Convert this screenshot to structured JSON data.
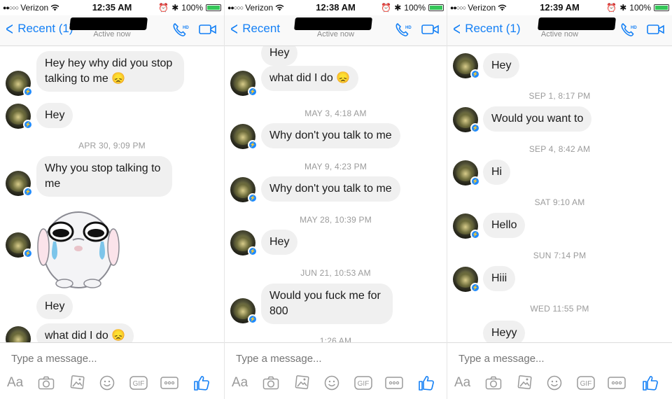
{
  "panels": [
    {
      "status": {
        "carrier": "Verizon",
        "time": "12:35 AM",
        "battery": "100%"
      },
      "nav": {
        "back_label": "Recent (1)",
        "subtitle": "Active now"
      },
      "messages": [
        {
          "type": "text",
          "text": "Hey hey why did you stop talking to me 😞"
        },
        {
          "type": "text",
          "text": "Hey"
        },
        {
          "type": "timestamp",
          "text": "APR 30, 9:09 PM"
        },
        {
          "type": "text",
          "text": "Why you stop talking to me"
        },
        {
          "type": "sticker",
          "description": "crying-bunny-sticker"
        },
        {
          "type": "text",
          "text": "Hey"
        },
        {
          "type": "text",
          "text": "what did I do 😞"
        }
      ],
      "composer": {
        "placeholder": "Type a message..."
      }
    },
    {
      "status": {
        "carrier": "Verizon",
        "time": "12:38 AM",
        "battery": "100%"
      },
      "nav": {
        "back_label": "Recent",
        "subtitle": "Active now"
      },
      "messages": [
        {
          "type": "text",
          "text": "Hey"
        },
        {
          "type": "text",
          "text": "what did I do 😞"
        },
        {
          "type": "timestamp",
          "text": "MAY 3, 4:18 AM"
        },
        {
          "type": "text",
          "text": "Why don't you talk to me"
        },
        {
          "type": "timestamp",
          "text": "MAY 9, 4:23 PM"
        },
        {
          "type": "text",
          "text": "Why don't you talk to me"
        },
        {
          "type": "timestamp",
          "text": "MAY 28, 10:39 PM"
        },
        {
          "type": "text",
          "text": "Hey"
        },
        {
          "type": "timestamp",
          "text": "JUN 21, 10:53 AM"
        },
        {
          "type": "text",
          "text": "Would you fuck me for 800"
        },
        {
          "type": "timestamp",
          "text": "1:26 AM"
        }
      ],
      "composer": {
        "placeholder": "Type a message..."
      }
    },
    {
      "status": {
        "carrier": "Verizon",
        "time": "12:39 AM",
        "battery": "100%"
      },
      "nav": {
        "back_label": "Recent (1)",
        "subtitle": "Active now"
      },
      "messages": [
        {
          "type": "text",
          "text": "Hey"
        },
        {
          "type": "timestamp",
          "text": "SEP 1, 8:17 PM"
        },
        {
          "type": "text",
          "text": "Would you want to"
        },
        {
          "type": "timestamp",
          "text": "SEP 4, 8:42 AM"
        },
        {
          "type": "text",
          "text": "Hi"
        },
        {
          "type": "timestamp",
          "text": "SAT 9:10 AM"
        },
        {
          "type": "text",
          "text": "Hello"
        },
        {
          "type": "timestamp",
          "text": "SUN 7:14 PM"
        },
        {
          "type": "text",
          "text": "Hiii"
        },
        {
          "type": "timestamp",
          "text": "WED 11:55 PM"
        },
        {
          "type": "text",
          "text": "Heyy"
        }
      ],
      "composer": {
        "placeholder": "Type a message..."
      }
    }
  ],
  "toolbar": {
    "aa_label": "Aa",
    "gif_label": "GIF",
    "icons": [
      "text-size-icon",
      "camera-icon",
      "photo-gallery-icon",
      "emoji-icon",
      "gif-icon",
      "more-icon",
      "like-icon"
    ]
  },
  "colors": {
    "accent": "#1580f5",
    "bubble": "#f0f0f0",
    "timestamp": "#9b9b9b"
  }
}
